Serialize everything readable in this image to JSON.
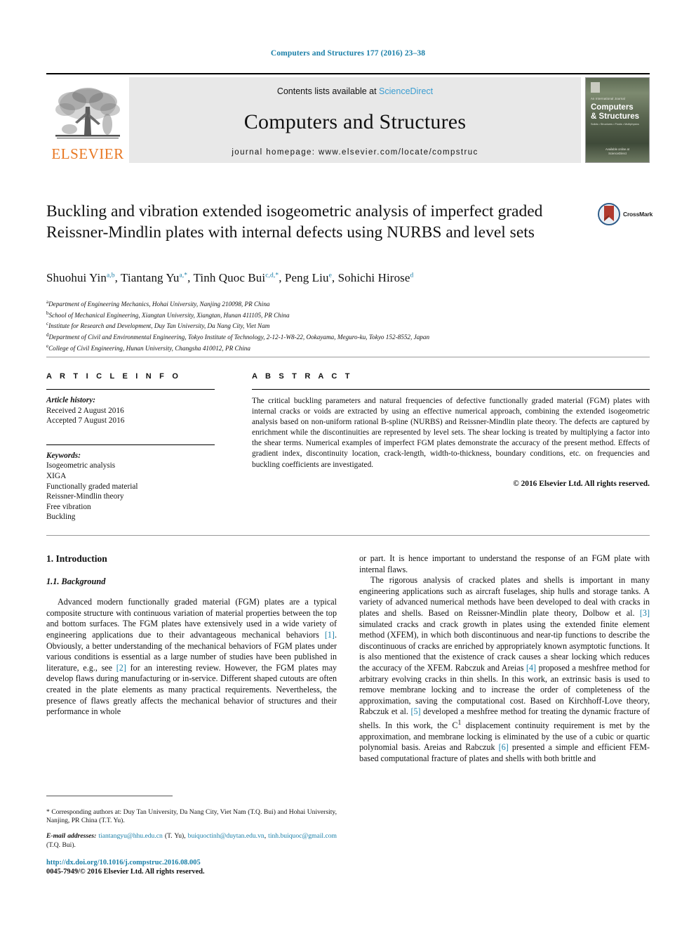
{
  "running_head": "Computers and Structures 177 (2016) 23–38",
  "masthead": {
    "publisher": "ELSEVIER",
    "contents_prefix": "Contents lists available at ",
    "contents_link": "ScienceDirect",
    "journal_title": "Computers and Structures",
    "homepage": "journal homepage: www.elsevier.com/locate/compstruc",
    "cover": {
      "subtitle": "An International Journal",
      "name_line1": "Computers",
      "name_line2": "& Structures",
      "tagline": "Solids • Structures • Fluids • Multiphysics",
      "footer_line1": "Available online at",
      "footer_line2": "ScienceDirect"
    }
  },
  "article": {
    "title": "Buckling and vibration extended isogeometric analysis of imperfect graded Reissner-Mindlin plates with internal defects using NURBS and level sets",
    "crossmark_label": "CrossMark",
    "authors": [
      {
        "name": "Shuohui Yin",
        "sup": "a,b",
        "sep": ", "
      },
      {
        "name": "Tiantang Yu",
        "sup": "a,*",
        "sep": ", "
      },
      {
        "name": "Tinh Quoc Bui",
        "sup": "c,d,*",
        "sep": ", "
      },
      {
        "name": "Peng Liu",
        "sup": "e",
        "sep": ", "
      },
      {
        "name": "Sohichi Hirose",
        "sup": "d",
        "sep": ""
      }
    ],
    "affiliations": [
      {
        "mark": "a",
        "text": "Department of Engineering Mechanics, Hohai University, Nanjing 210098, PR China"
      },
      {
        "mark": "b",
        "text": "School of Mechanical Engineering, Xiangtan University, Xiangtan, Hunan 411105, PR China"
      },
      {
        "mark": "c",
        "text": "Institute for Research and Development, Duy Tan University, Da Nang City, Viet Nam"
      },
      {
        "mark": "d",
        "text": "Department of Civil and Environmental Engineering, Tokyo Institute of Technology, 2-12-1-W8-22, Ookayama, Meguro-ku, Tokyo 152-8552, Japan"
      },
      {
        "mark": "e",
        "text": "College of Civil Engineering, Hunan University, Changsha 410012, PR China"
      }
    ]
  },
  "article_info": {
    "heading": "A R T I C L E   I N F O",
    "history_label": "Article history:",
    "history": [
      "Received 2 August 2016",
      "Accepted 7 August 2016"
    ],
    "keywords_label": "Keywords:",
    "keywords": [
      "Isogeometric analysis",
      "XIGA",
      "Functionally graded material",
      "Reissner-Mindlin theory",
      "Free vibration",
      "Buckling"
    ]
  },
  "abstract": {
    "heading": "A B S T R A C T",
    "text": "The critical buckling parameters and natural frequencies of defective functionally graded material (FGM) plates with internal cracks or voids are extracted by using an effective numerical approach, combining the extended isogeometric analysis based on non-uniform rational B-spline (NURBS) and Reissner-Mindlin plate theory. The defects are captured by enrichment while the discontinuities are represented by level sets. The shear locking is treated by multiplying a factor into the shear terms. Numerical examples of imperfect FGM plates demonstrate the accuracy of the present method. Effects of gradient index, discontinuity location, crack-length, width-to-thickness, boundary conditions, etc. on frequencies and buckling coefficients are investigated.",
    "copyright": "© 2016 Elsevier Ltd. All rights reserved."
  },
  "body": {
    "section_number_title": "1. Introduction",
    "subsection_title": "1.1. Background",
    "left_paragraph_1": "Advanced modern functionally graded material (FGM) plates are a typical composite structure with continuous variation of material properties between the top and bottom surfaces. The FGM plates have extensively used in a wide variety of engineering applications due to their advantageous mechanical behaviors",
    "left_ref_1": "[1]",
    "left_paragraph_1b": ". Obviously, a better understanding of the mechanical behaviors of FGM plates under various conditions is essential as a large number of studies have been published in literature, e.g., see",
    "left_ref_2": "[2]",
    "left_paragraph_1c": "for an interesting review. However, the FGM plates may develop flaws during manufacturing or in-service. Different shaped cutouts are often created in the plate elements as many practical requirements. Nevertheless, the presence of flaws greatly affects the mechanical behavior of structures and their performance in whole",
    "right_paragraph_1": "or part. It is hence important to understand the response of an FGM plate with internal flaws.",
    "right_paragraph_2a": "The rigorous analysis of cracked plates and shells is important in many engineering applications such as aircraft fuselages, ship hulls and storage tanks. A variety of advanced numerical methods have been developed to deal with cracks in plates and shells. Based on Reissner-Mindlin plate theory, Dolbow et al.",
    "right_ref_3": "[3]",
    "right_paragraph_2b": "simulated cracks and crack growth in plates using the extended finite element method (XFEM), in which both discontinuous and near-tip functions to describe the discontinuous of cracks are enriched by appropriately known asymptotic functions. It is also mentioned that the existence of crack causes a shear locking which reduces the accuracy of the XFEM. Rabczuk and Areias",
    "right_ref_4": "[4]",
    "right_paragraph_2c": "proposed a meshfree method for arbitrary evolving cracks in thin shells. In this work, an extrinsic basis is used to remove membrane locking and to increase the order of completeness of the approximation, saving the computational cost. Based on Kirchhoff-Love theory, Rabczuk et al.",
    "right_ref_5": "[5]",
    "right_paragraph_2d_pre": "developed a meshfree method for treating the dynamic fracture of shells. In this work, the C",
    "right_superscript": "1",
    "right_paragraph_2d_post": " displacement continuity requirement is met by the approximation, and membrane locking is eliminated by the use of a cubic or quartic polynomial basis. Areias and Rabczuk",
    "right_ref_6": "[6]",
    "right_paragraph_2e": "presented a simple and efficient FEM-based computational fracture of plates and shells with both brittle and"
  },
  "footnotes": {
    "corresponding_mark": "*",
    "corresponding_text": "Corresponding authors at: Duy Tan University, Da Nang City, Viet Nam (T.Q. Bui) and Hohai University, Nanjing, PR China (T.T. Yu).",
    "email_label": "E-mail addresses:",
    "email_1": "tiantangyu@hhu.edu.cn",
    "email_1_owner": " (T. Yu), ",
    "email_2": "buiquoctinh@duytan.edu.vn",
    "email_2_sep": ", ",
    "email_3": "tinh.buiquoc@gmail.com",
    "email_3_owner": " (T.Q. Bui)."
  },
  "bottom": {
    "doi": "http://dx.doi.org/10.1016/j.compstruc.2016.08.005",
    "issn_copyright": "0045-7949/© 2016 Elsevier Ltd. All rights reserved."
  },
  "colors": {
    "link_blue": "#1a7fa8",
    "sciencedirect_blue": "#3b9dd1",
    "elsevier_orange": "#E87722",
    "crossmark_red": "#B03A2E",
    "band_gray": "#e8e8e8"
  }
}
